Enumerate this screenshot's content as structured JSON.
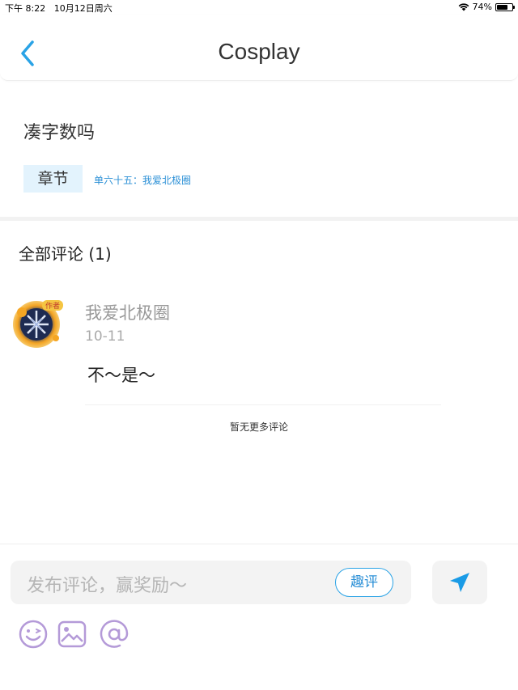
{
  "status_bar": {
    "time": "下午 8:22",
    "date": "10月12日周六",
    "battery": "74%",
    "battery_level": 0.74,
    "icons": [
      "wifi-icon",
      "battery-icon"
    ]
  },
  "nav": {
    "title": "Cosplay",
    "back_icon": "chevron-left-icon"
  },
  "post": {
    "text": "凑字数吗",
    "chapter_tag": "章节",
    "chapter_link": "单六十五：我爱北极圈"
  },
  "comments": {
    "header": "全部评论 (1)",
    "items": [
      {
        "username": "我爱北极圈",
        "date": "10-11",
        "body": "不～是～",
        "avatar_badge": "作者"
      }
    ],
    "no_more": "暂无更多评论"
  },
  "composer": {
    "placeholder": "发布评论，赢奖励～",
    "qu_ping_label": "趣评",
    "send_icon": "send-icon",
    "tools": [
      "emoji-icon",
      "image-icon",
      "mention-icon"
    ]
  },
  "colors": {
    "accent": "#2aa3e6",
    "tag_bg": "#e3f3fd",
    "tool_icon": "#b49ad8"
  }
}
